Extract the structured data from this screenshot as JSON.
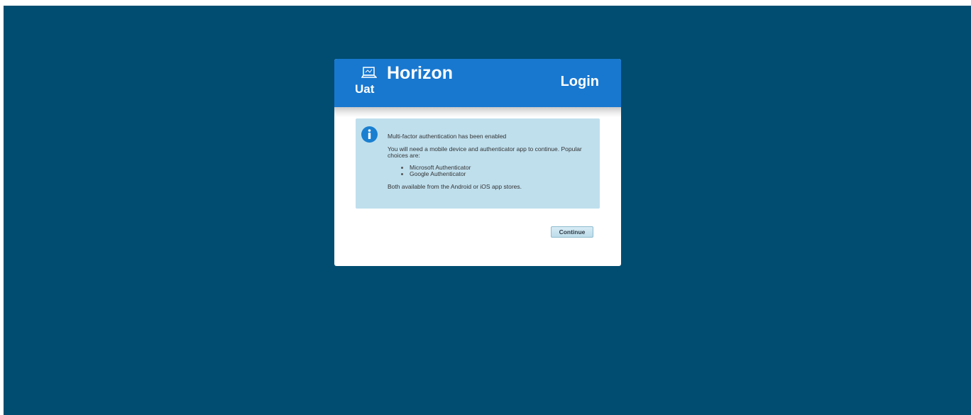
{
  "header": {
    "app_icon": "laptop-icon",
    "environment": "Uat",
    "app_name": "Horizon",
    "page_title": "Login"
  },
  "info": {
    "icon": "info-icon",
    "heading": "Multi-factor authentication has been enabled",
    "body": "You will need a mobile device and authenticator app to continue. Popular choices are:",
    "apps": [
      "Microsoft Authenticator",
      "Google Authenticator"
    ],
    "footer": "Both available from the Android or iOS app stores."
  },
  "actions": {
    "continue_label": "Continue"
  },
  "colors": {
    "background": "#004d71",
    "header": "#1878d0",
    "info_box": "#bfdfed",
    "info_icon": "#1a7fd0"
  }
}
